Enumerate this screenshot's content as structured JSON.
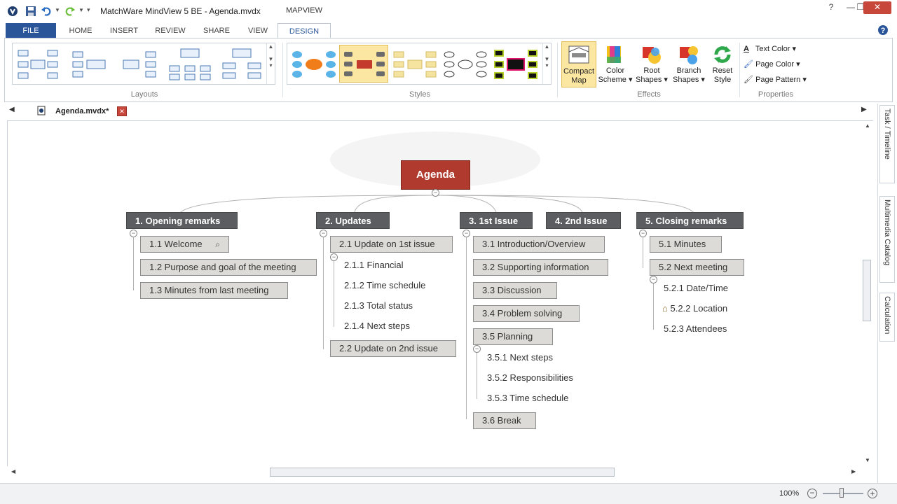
{
  "window": {
    "app_title": "MatchWare MindView 5 BE - Agenda.mvdx",
    "context_tab_title": "MAPVIEW"
  },
  "tabs": [
    "FILE",
    "HOME",
    "INSERT",
    "REVIEW",
    "SHARE",
    "VIEW",
    "DESIGN"
  ],
  "ribbon": {
    "groups": {
      "layouts": "Layouts",
      "styles": "Styles",
      "effects": "Effects",
      "properties": "Properties"
    },
    "effects": {
      "compact_map": [
        "Compact",
        "Map"
      ],
      "color_scheme": [
        "Color",
        "Scheme"
      ],
      "root_shapes": [
        "Root",
        "Shapes"
      ],
      "branch_shapes": [
        "Branch",
        "Shapes"
      ],
      "reset_style": [
        "Reset",
        "Style"
      ]
    },
    "properties": {
      "text_color": "Text Color",
      "page_color": "Page Color",
      "page_pattern": "Page Pattern"
    }
  },
  "document_tab": "Agenda.mvdx*",
  "side_tabs": [
    "Task / Timeline",
    "Multimedia Catalog",
    "Calculation"
  ],
  "map": {
    "root": "Agenda",
    "topics": [
      {
        "label": "1.  Opening remarks",
        "children": [
          "1.1  Welcome",
          "1.2  Purpose and goal of the meeting",
          "1.3  Minutes from last meeting"
        ]
      },
      {
        "label": "2.  Updates",
        "children": [
          "2.1  Update on 1st issue",
          "2.2  Update on 2nd issue"
        ],
        "grandchildren": [
          "2.1.1  Financial",
          "2.1.2  Time schedule",
          "2.1.3  Total status",
          "2.1.4  Next steps"
        ]
      },
      {
        "label": "3.  1st Issue",
        "children": [
          "3.1  Introduction/Overview",
          "3.2  Supporting information",
          "3.3  Discussion",
          "3.4  Problem solving",
          "3.5  Planning",
          "3.6  Break"
        ],
        "grandchildren": [
          "3.5.1  Next steps",
          "3.5.2  Responsibilities",
          "3.5.3  Time schedule"
        ]
      },
      {
        "label": "4.  2nd Issue",
        "children": []
      },
      {
        "label": "5.  Closing remarks",
        "children": [
          "5.1  Minutes",
          "5.2  Next meeting"
        ],
        "grandchildren": [
          "5.2.1  Date/Time",
          "5.2.2  Location",
          "5.2.3  Attendees"
        ]
      }
    ]
  },
  "status": {
    "zoom": "100%"
  },
  "colors": {
    "root": "#b03a2e",
    "main_topic": "#5b5d60",
    "sub_topic": "#dcdbd7",
    "file_tab": "#2a5699"
  }
}
